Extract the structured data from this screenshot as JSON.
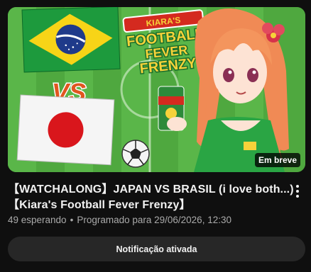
{
  "video": {
    "title_line1": "【WATCHALONG】JAPAN VS BRASIL (i love both...)",
    "title_line2": "【Kiara's Football Fever Frenzy】",
    "badge": "Em breve",
    "waiting": "49 esperando",
    "separator": "•",
    "scheduled": "Programado para 29/06/2026, 12:30",
    "notify_button": "Notificação ativada",
    "menu_icon": "more-vert-icon"
  },
  "thumbnail": {
    "logo_top": "KIARA'S",
    "logo_line1": "FOOTBALL",
    "logo_line2": "FEVER",
    "logo_line3": "FRENZY",
    "vs_text": "VS",
    "flags": [
      "Brazil",
      "Japan"
    ],
    "colors": {
      "pitch": "#4fa83f",
      "logo_red": "#d42a1f",
      "logo_yellow": "#f6d23a",
      "logo_green": "#2e9a3e"
    }
  },
  "colors": {
    "background": "#0f0f0f",
    "text_primary": "#f1f1f1",
    "text_secondary": "#aaaaaa",
    "button_bg": "#272727"
  }
}
